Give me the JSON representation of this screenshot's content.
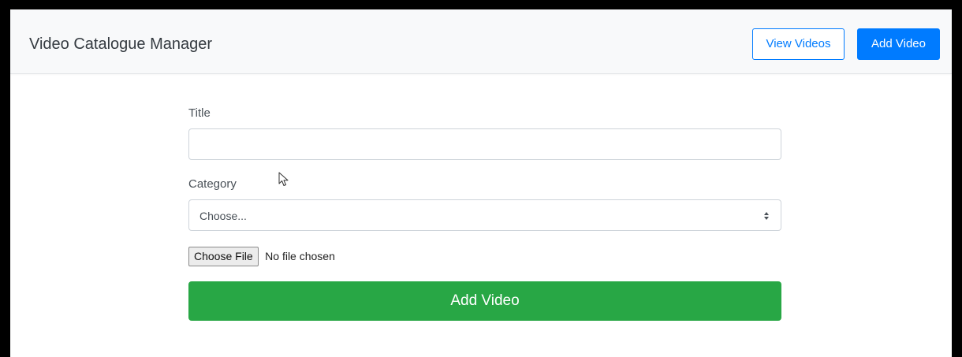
{
  "navbar": {
    "brand": "Video Catalogue Manager",
    "view_videos_label": "View Videos",
    "add_video_label": "Add Video"
  },
  "form": {
    "title_label": "Title",
    "title_value": "",
    "category_label": "Category",
    "category_selected": "Choose...",
    "file_button_label": "Choose File",
    "file_status": "No file chosen",
    "submit_label": "Add Video"
  },
  "colors": {
    "primary": "#007bff",
    "success": "#28a745",
    "navbar_bg": "#f8f9fa"
  },
  "icons": {
    "select_arrow": "sort-arrows-icon",
    "cursor": "mouse-pointer-icon"
  }
}
